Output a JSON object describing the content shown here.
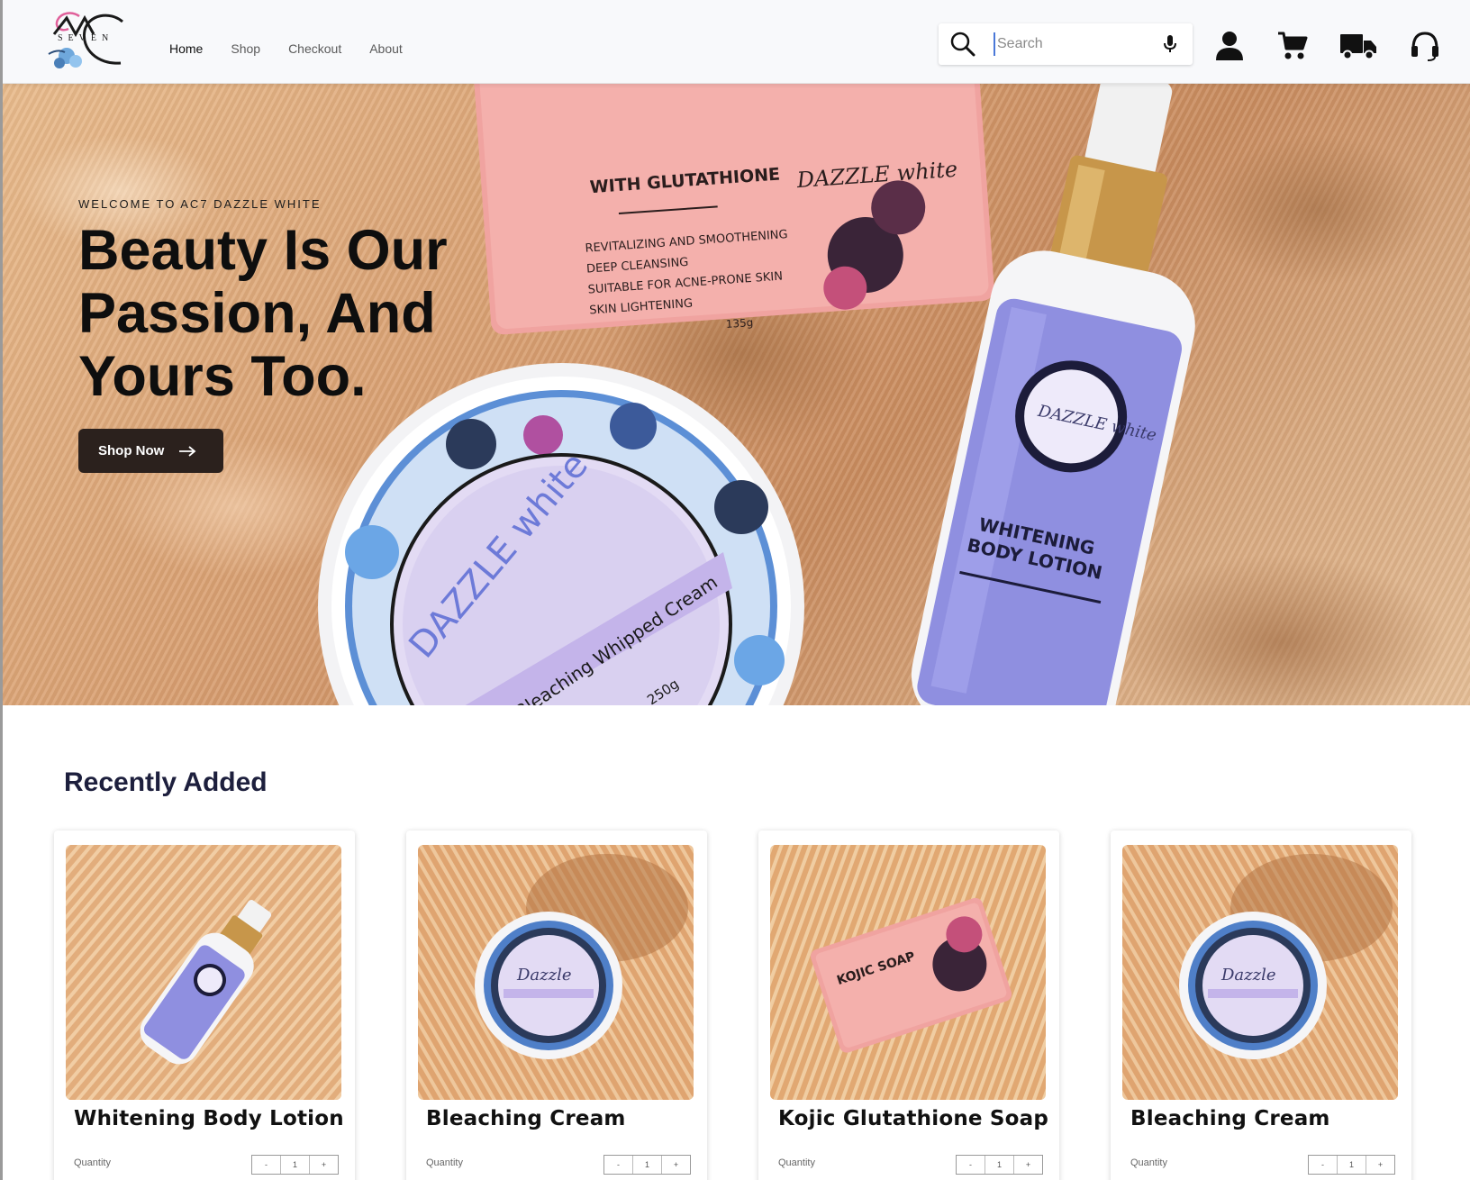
{
  "brand": {
    "logo_letters": "AC",
    "logo_word": "SEVEN"
  },
  "nav": {
    "links": [
      "Home",
      "Shop",
      "Checkout",
      "About"
    ],
    "active": "Home"
  },
  "search": {
    "placeholder": "Search"
  },
  "header_icons": [
    "search-icon",
    "mic-icon",
    "user-icon",
    "cart-icon",
    "truck-icon",
    "headset-icon"
  ],
  "hero": {
    "eyebrow": "WELCOME TO AC7 DAZZLE WHITE",
    "title": "Beauty Is Our Passion, And Yours Too.",
    "cta_label": "Shop Now",
    "soap_label": {
      "top": "WITH GLUTATHIONE",
      "lines": [
        "REVITALIZING AND SMOOTHENING",
        "DEEP CLEANSING",
        "SUITABLE FOR ACNE-PRONE SKIN",
        "SKIN LIGHTENING"
      ],
      "weight": "135g",
      "brand": "DAZZLE white"
    },
    "cream_label": {
      "brand": "DAZZLE white",
      "product": "Bleaching Whipped Cream",
      "weight": "250g"
    },
    "lotion_label": {
      "line1": "WHITENING",
      "line2": "BODY LOTION",
      "brand": "DAZZLE white"
    }
  },
  "recent": {
    "title": "Recently Added",
    "quantity_label": "Quantity",
    "products": [
      {
        "name": "Whitening Body Lotion",
        "qty": "1",
        "kind": "lotion"
      },
      {
        "name": "Bleaching Cream",
        "qty": "1",
        "kind": "cream"
      },
      {
        "name": "Kojic Glutathione Soap",
        "qty": "1",
        "kind": "soap"
      },
      {
        "name": "Bleaching Cream",
        "qty": "1",
        "kind": "cream"
      }
    ],
    "stepper": {
      "minus": "-",
      "plus": "+"
    }
  },
  "colors": {
    "fur_light": "#e9bb8c",
    "fur_dark": "#c98b5e",
    "cta_bg": "#2b211d",
    "soap_pink": "#f0a3a0",
    "lotion_purple": "#8f8fe0",
    "cream_lilac": "#dcd0f0",
    "heading_navy": "#1d1f3d"
  }
}
